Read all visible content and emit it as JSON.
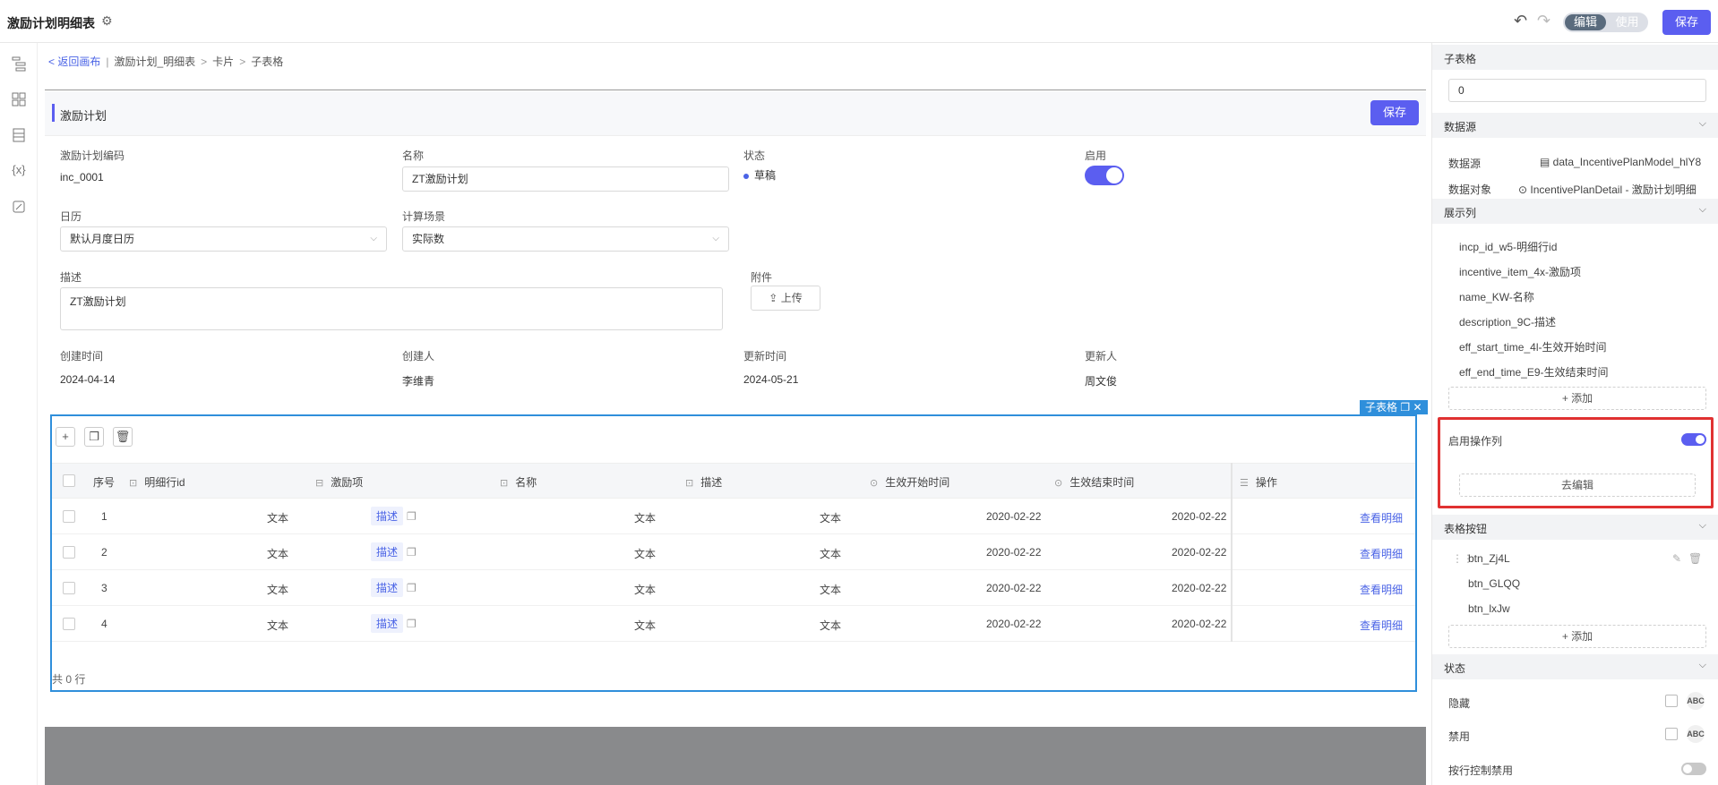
{
  "topbar": {
    "title": "激励计划明细表",
    "mode_edit": "编辑",
    "mode_use": "使用",
    "save_label": "保存"
  },
  "breadcrumb": {
    "back": "< 返回画布",
    "items": [
      "激励计划_明细表",
      "卡片",
      "子表格"
    ]
  },
  "form": {
    "title": "激励计划",
    "save_label": "保存",
    "fields": {
      "code_label": "激励计划编码",
      "code_value": "inc_0001",
      "name_label": "名称",
      "name_value": "ZT激励计划",
      "status_label": "状态",
      "status_value": "草稿",
      "enabled_label": "启用",
      "calendar_label": "日历",
      "calendar_value": "默认月度日历",
      "scene_label": "计算场景",
      "scene_value": "实际数",
      "desc_label": "描述",
      "desc_value": "ZT激励计划",
      "attach_label": "附件",
      "upload_label": "上传",
      "created_label": "创建时间",
      "created_value": "2024-04-14",
      "creator_label": "创建人",
      "creator_value": "李维青",
      "updated_label": "更新时间",
      "updated_value": "2024-05-21",
      "updater_label": "更新人",
      "updater_value": "周文俊"
    }
  },
  "subtable": {
    "tag": "子表格",
    "columns": [
      "序号",
      "明细行id",
      "激励项",
      "名称",
      "描述",
      "生效开始时间",
      "生效结束时间",
      "操作"
    ],
    "rows": [
      {
        "no": "1",
        "id": "文本",
        "item": "描述",
        "name": "文本",
        "desc": "文本",
        "start": "2020-02-22",
        "end": "2020-02-22",
        "op": "查看明细"
      },
      {
        "no": "2",
        "id": "文本",
        "item": "描述",
        "name": "文本",
        "desc": "文本",
        "start": "2020-02-22",
        "end": "2020-02-22",
        "op": "查看明细"
      },
      {
        "no": "3",
        "id": "文本",
        "item": "描述",
        "name": "文本",
        "desc": "文本",
        "start": "2020-02-22",
        "end": "2020-02-22",
        "op": "查看明细"
      },
      {
        "no": "4",
        "id": "文本",
        "item": "描述",
        "name": "文本",
        "desc": "文本",
        "start": "2020-02-22",
        "end": "2020-02-22",
        "op": "查看明细"
      }
    ],
    "total": "共 0 行"
  },
  "panel": {
    "subtable_title": "子表格",
    "subtable_value": "0",
    "datasource_title": "数据源",
    "datasource_label": "数据源",
    "datasource_value": "data_IncentivePlanModel_hlY8",
    "object_label": "数据对象",
    "object_value": "IncentivePlanDetail - 激励计划明细",
    "columns_title": "展示列",
    "columns": [
      "incp_id_w5-明细行id",
      "incentive_item_4x-激励项",
      "name_KW-名称",
      "description_9C-描述",
      "eff_start_time_4l-生效开始时间",
      "eff_end_time_E9-生效结束时间"
    ],
    "add_label": "+ 添加",
    "op_col_label": "启用操作列",
    "edit_label": "去编辑",
    "buttons_title": "表格按钮",
    "buttons": [
      "btn_Zj4L",
      "btn_GLQQ",
      "btn_lxJw"
    ],
    "state_title": "状态",
    "hidden_label": "隐藏",
    "disabled_label": "禁用",
    "row_disable_label": "按行控制禁用",
    "abc": "ABC"
  },
  "colors": {
    "primary": "#5b5ef0",
    "subtable_border": "#2f8fdb",
    "highlight": "#e03131"
  }
}
